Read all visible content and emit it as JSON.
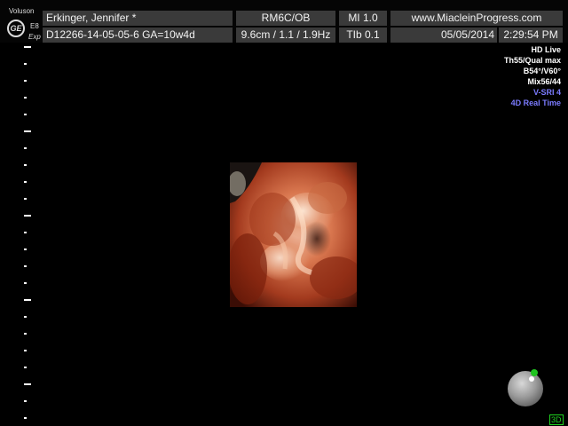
{
  "brand": {
    "product": "Voluson",
    "logo": "GE",
    "model": "E8",
    "variant": "Exp"
  },
  "header": {
    "patient_name": "Erkinger, Jennifer  *",
    "patient_id": "D12266-14-05-05-6  GA=10w4d",
    "probe": "RM6C/OB",
    "depth_settings": "9.6cm / 1.1 / 1.9Hz",
    "mi": "MI  1.0",
    "tib": "TIb  0.1",
    "website": "www.MiacleinProgress.com",
    "date": "05/05/2014",
    "time": "2:29:54 PM"
  },
  "imaging_params": {
    "lines": [
      {
        "text": "HD Live",
        "color": "#ffffff"
      },
      {
        "text": "Th55/Qual max",
        "color": "#ffffff"
      },
      {
        "text": "B54°/V60°",
        "color": "#ffffff"
      },
      {
        "text": "Mix56/44",
        "color": "#ffffff"
      },
      {
        "text": "V-SRI 4",
        "color": "#7b7bff"
      },
      {
        "text": "4D Real Time",
        "color": "#7b7bff"
      }
    ]
  },
  "mode_indicator": "3D",
  "colors": {
    "accent_green": "#1fd21f",
    "accent_blue": "#7b7bff",
    "header_cell": "#3a3a3a"
  }
}
